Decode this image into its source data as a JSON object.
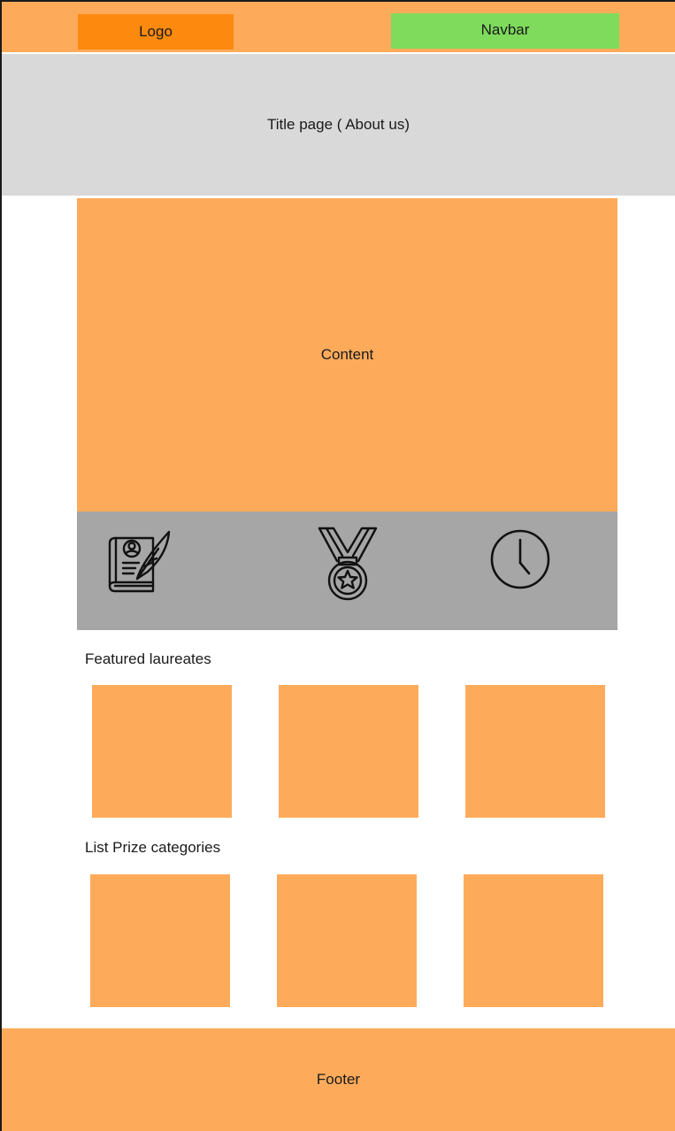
{
  "header": {
    "logo_label": "Logo",
    "navbar_label": "Navbar"
  },
  "title_band": {
    "text": "Title page ( About us)"
  },
  "content": {
    "text": "Content"
  },
  "icons": [
    {
      "name": "book-quill-icon"
    },
    {
      "name": "medal-icon"
    },
    {
      "name": "clock-icon"
    }
  ],
  "featured_laureates": {
    "heading": "Featured laureates",
    "cards": 3
  },
  "prize_categories": {
    "heading": "List Prize categories",
    "cards": 3
  },
  "footer": {
    "text": "Footer"
  },
  "colors": {
    "orange_light": "#fdab5b",
    "orange_dark": "#fd8a0f",
    "green": "#7fdb5c",
    "gray_light": "#d9d9d9",
    "gray_strip": "#a6a6a6"
  }
}
